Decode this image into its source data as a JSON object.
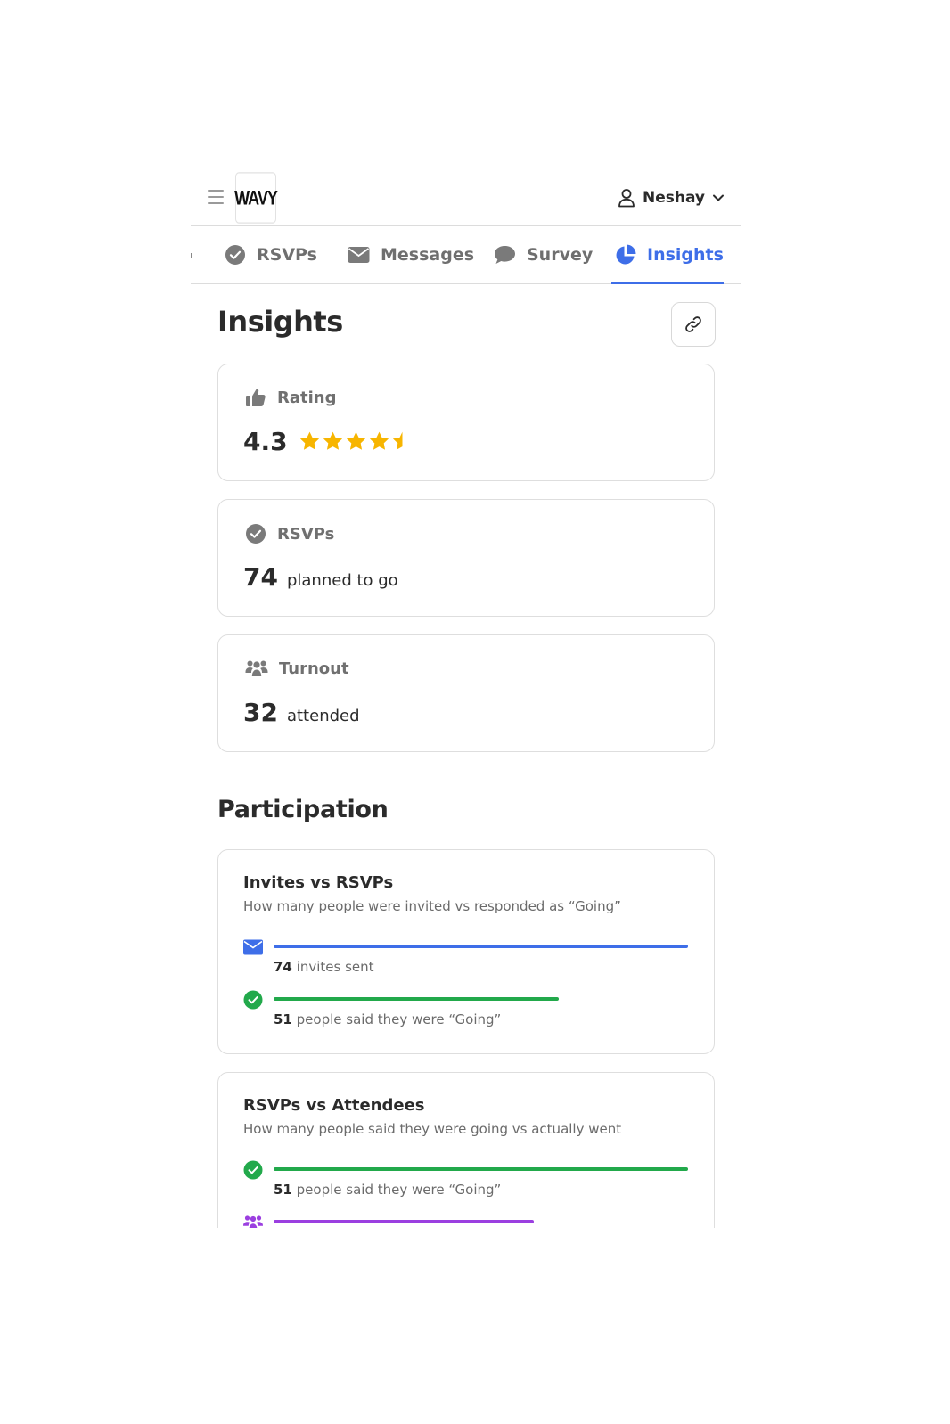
{
  "header": {
    "logo_text": "WAVY",
    "user_name": "Neshay"
  },
  "tabs": [
    {
      "label": "RSVPs",
      "icon": "check-circle-icon",
      "active": false
    },
    {
      "label": "Messages",
      "icon": "envelope-icon",
      "active": false
    },
    {
      "label": "Survey",
      "icon": "chat-bubble-icon",
      "active": false
    },
    {
      "label": "Insights",
      "icon": "pie-chart-icon",
      "active": true
    }
  ],
  "page": {
    "title": "Insights"
  },
  "stats": {
    "rating": {
      "label": "Rating",
      "value": "4.3",
      "stars": 4.3
    },
    "rsvps": {
      "label": "RSVPs",
      "value": "74",
      "suffix": "planned to go"
    },
    "turnout": {
      "label": "Turnout",
      "value": "32",
      "suffix": "attended"
    }
  },
  "participation": {
    "title": "Participation",
    "cards": [
      {
        "title": "Invites vs RSVPs",
        "description": "How many people were invited vs responded as “Going”",
        "rows": [
          {
            "icon": "envelope-icon",
            "color": "#3e6ee8",
            "fraction": 1.0,
            "count": "74",
            "text": "invites sent"
          },
          {
            "icon": "check-circle-icon",
            "color": "#22a94b",
            "fraction": 0.689,
            "count": "51",
            "text": "people said they were “Going”"
          }
        ]
      },
      {
        "title": "RSVPs vs Attendees",
        "description": "How many people said they were going vs actually went",
        "rows": [
          {
            "icon": "check-circle-icon",
            "color": "#22a94b",
            "fraction": 1.0,
            "count": "51",
            "text": "people said they were “Going”"
          },
          {
            "icon": "people-icon",
            "color": "#9b3fe0",
            "fraction": 0.627,
            "count": "",
            "text": ""
          }
        ]
      }
    ]
  },
  "colors": {
    "accent": "#3e6ee8",
    "star": "#f7b500",
    "going": "#22a94b",
    "attended": "#9b3fe0"
  }
}
